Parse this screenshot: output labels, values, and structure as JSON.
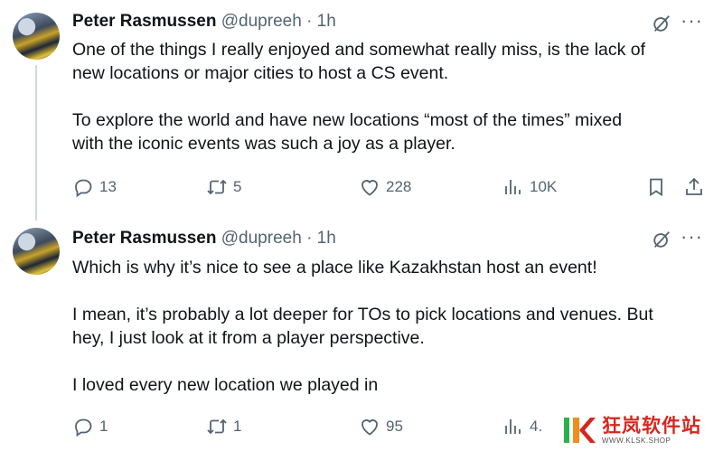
{
  "tweets": [
    {
      "author": "Peter Rasmussen",
      "handle": "@dupreeh",
      "separator": "·",
      "time": "1h",
      "lines": [
        "One of the things I really enjoyed and somewhat really miss, is the lack of",
        "new locations or major cities to host a CS event.",
        "",
        "To explore the world and have new locations “most of the times” mixed",
        "with the iconic events was such a joy as a player."
      ],
      "actions": {
        "replies": "13",
        "retweets": "5",
        "likes": "228",
        "views": "10K"
      }
    },
    {
      "author": "Peter Rasmussen",
      "handle": "@dupreeh",
      "separator": "·",
      "time": "1h",
      "lines": [
        "Which is why it’s nice to see a place like Kazakhstan host an event!",
        "",
        "I mean, it’s probably a lot deeper for TOs to pick locations and venues. But",
        "hey, I just look at it from a player perspective.",
        "",
        "I loved every new location we played in"
      ],
      "actions": {
        "replies": "1",
        "retweets": "1",
        "likes": "95",
        "views": "4."
      }
    }
  ],
  "more_glyph": "···",
  "watermark": {
    "name": "狂岚软件站",
    "url": "WWW.KLSK.SHOP"
  },
  "colors": {
    "text": "#0f1419",
    "muted": "#536471",
    "thread_line": "#cfd9de",
    "watermark_red": "#d7261e",
    "watermark_green": "#2bb24c",
    "watermark_orange": "#f28c1a"
  },
  "icons": [
    "grok-icon",
    "more-icon",
    "reply-icon",
    "retweet-icon",
    "like-icon",
    "views-icon",
    "bookmark-icon",
    "share-icon"
  ]
}
